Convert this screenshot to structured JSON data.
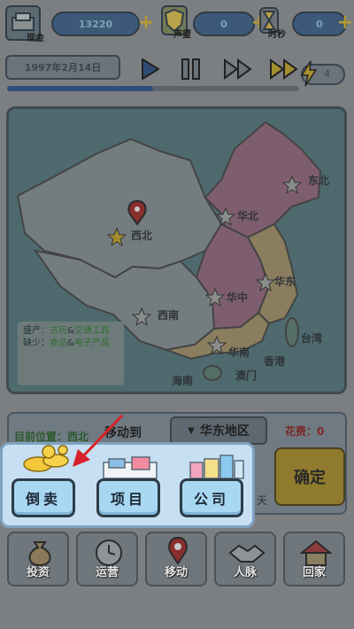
{
  "top_bar": {
    "cash_label": "现金",
    "cash_value": "13220",
    "reputation_label": "声望",
    "reputation_value": "0",
    "time_label": "时秒",
    "time_value": "0"
  },
  "controls": {
    "date": "1997年2月14日",
    "speed_badge": "4",
    "progress": 0.5
  },
  "map": {
    "regions": [
      "东北",
      "华北",
      "西北",
      "华东",
      "华中",
      "西南",
      "华南",
      "台湾",
      "香港",
      "澳门",
      "海南"
    ],
    "legend_produce_prefix": "盛产：",
    "legend_produce_a": "古玩",
    "legend_amp": "&",
    "legend_produce_b": "交通工具",
    "legend_lack_prefix": "缺少：",
    "legend_lack_a": "食品",
    "legend_lack_b": "电子产品"
  },
  "info": {
    "current_location": "目前位置：西北",
    "move_to": "移动到",
    "destination": "华东地区",
    "cost": "花费：0",
    "confirm": "确定",
    "hint_tail": "天"
  },
  "popup": {
    "resell": "倒卖",
    "project": "项目",
    "company": "公司"
  },
  "nav": {
    "invest": "投资",
    "operate": "运营",
    "move": "移动",
    "contacts": "人脉",
    "home": "回家"
  },
  "colors": {
    "highlight_popup": "#c7dff2",
    "button_blue": "#a8d7f2",
    "arrow_red": "#d8222a",
    "dim_overlay": "#7c7f82"
  }
}
